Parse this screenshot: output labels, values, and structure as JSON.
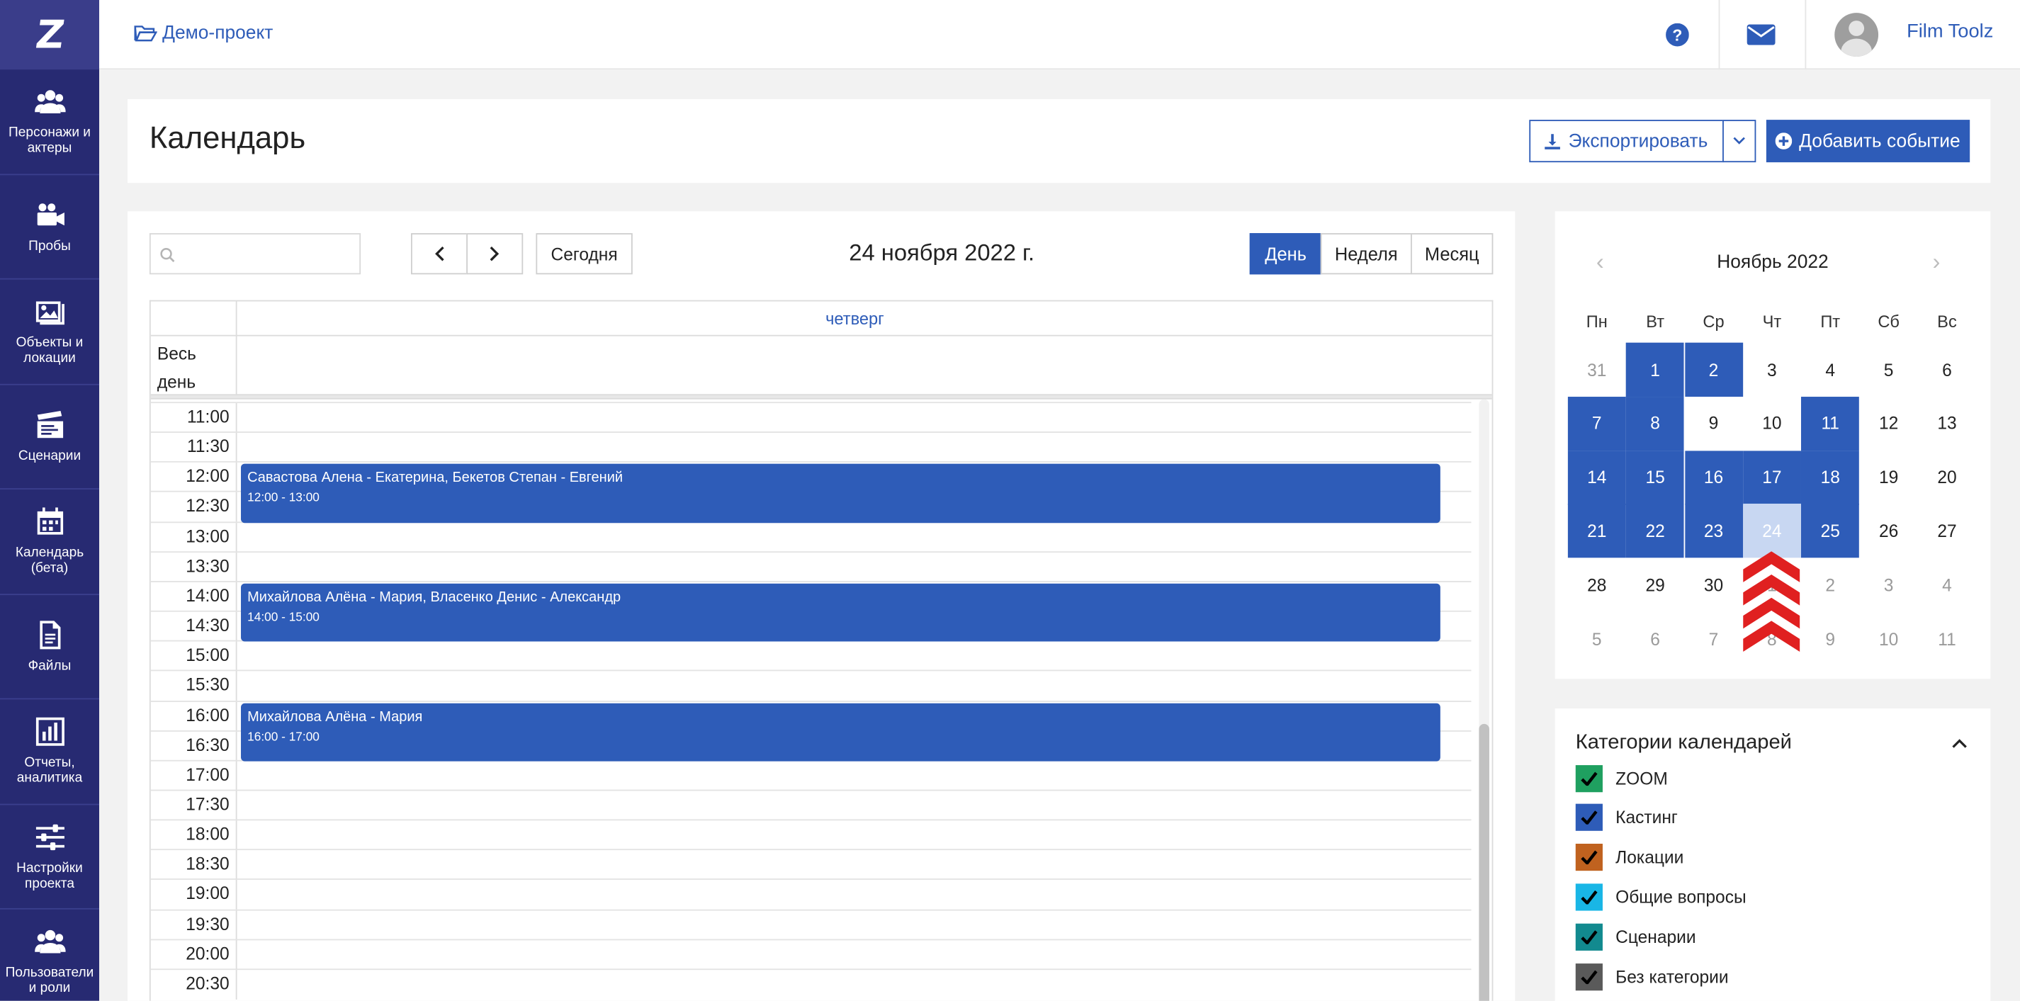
{
  "sidebar": {
    "logo": "Z",
    "items": [
      {
        "label": "Персонажи и актеры",
        "icon": "people-icon"
      },
      {
        "label": "Пробы",
        "icon": "video-camera-icon"
      },
      {
        "label": "Объекты и локации",
        "icon": "image-icon"
      },
      {
        "label": "Сценарии",
        "icon": "clapperboard-icon"
      },
      {
        "label": "Календарь (бета)",
        "icon": "calendar-icon"
      },
      {
        "label": "Файлы",
        "icon": "file-icon"
      },
      {
        "label": "Отчеты, аналитика",
        "icon": "bar-chart-icon"
      },
      {
        "label": "Настройки проекта",
        "icon": "sliders-icon"
      },
      {
        "label": "Пользователи и роли",
        "icon": "users-icon"
      }
    ]
  },
  "topbar": {
    "project": "Демо-проект",
    "user": "Film Toolz"
  },
  "header": {
    "title": "Календарь",
    "export_label": "Экспортировать",
    "add_label": "Добавить событие"
  },
  "calendar": {
    "search_placeholder": "",
    "today_label": "Сегодня",
    "current_date": "24 ноября 2022 г.",
    "views": [
      "День",
      "Неделя",
      "Месяц"
    ],
    "active_view": "День",
    "day_name": "четверг",
    "allday_label": "Весь день",
    "times": [
      "11:00",
      "11:30",
      "12:00",
      "12:30",
      "13:00",
      "13:30",
      "14:00",
      "14:30",
      "15:00",
      "15:30",
      "16:00",
      "16:30",
      "17:00",
      "17:30",
      "18:00",
      "18:30",
      "19:00",
      "19:30",
      "20:00",
      "20:30"
    ],
    "events": [
      {
        "title": "Савастова Алена - Екатерина, Бекетов Степан - Евгений",
        "time": "12:00 - 13:00",
        "start": "12:00",
        "end": "13:00"
      },
      {
        "title": "Михайлова Алёна - Мария, Власенко Денис - Александр",
        "time": "14:00 - 15:00",
        "start": "14:00",
        "end": "15:00"
      },
      {
        "title": "Михайлова Алёна - Мария",
        "time": "16:00 - 17:00",
        "start": "16:00",
        "end": "17:00"
      }
    ]
  },
  "mini_calendar": {
    "title": "Ноябрь 2022",
    "weekdays": [
      "Пн",
      "Вт",
      "Ср",
      "Чт",
      "Пт",
      "Сб",
      "Вс"
    ],
    "weeks": [
      [
        "31",
        "1",
        "2",
        "3",
        "4",
        "5",
        "6"
      ],
      [
        "7",
        "8",
        "9",
        "10",
        "11",
        "12",
        "13"
      ],
      [
        "14",
        "15",
        "16",
        "17",
        "18",
        "19",
        "20"
      ],
      [
        "21",
        "22",
        "23",
        "24",
        "25",
        "26",
        "27"
      ],
      [
        "28",
        "29",
        "30",
        "1",
        "2",
        "3",
        "4"
      ],
      [
        "5",
        "6",
        "7",
        "8",
        "9",
        "10",
        "11"
      ]
    ],
    "highlighted": [
      "1",
      "2",
      "7",
      "8",
      "11",
      "14",
      "15",
      "16",
      "17",
      "18",
      "21",
      "22",
      "23",
      "25"
    ],
    "selected": "24",
    "accent": "#2e5cb8",
    "selected_color": "#c8d7f2"
  },
  "categories": {
    "title": "Категории календарей",
    "items": [
      {
        "label": "ZOOM",
        "color": "#1fa060"
      },
      {
        "label": "Кастинг",
        "color": "#2e5cb8"
      },
      {
        "label": "Локации",
        "color": "#c0621f"
      },
      {
        "label": "Общие вопросы",
        "color": "#19b6e6"
      },
      {
        "label": "Сценарии",
        "color": "#128a8f"
      },
      {
        "label": "Без категории",
        "color": "#5a5a5a"
      }
    ]
  }
}
